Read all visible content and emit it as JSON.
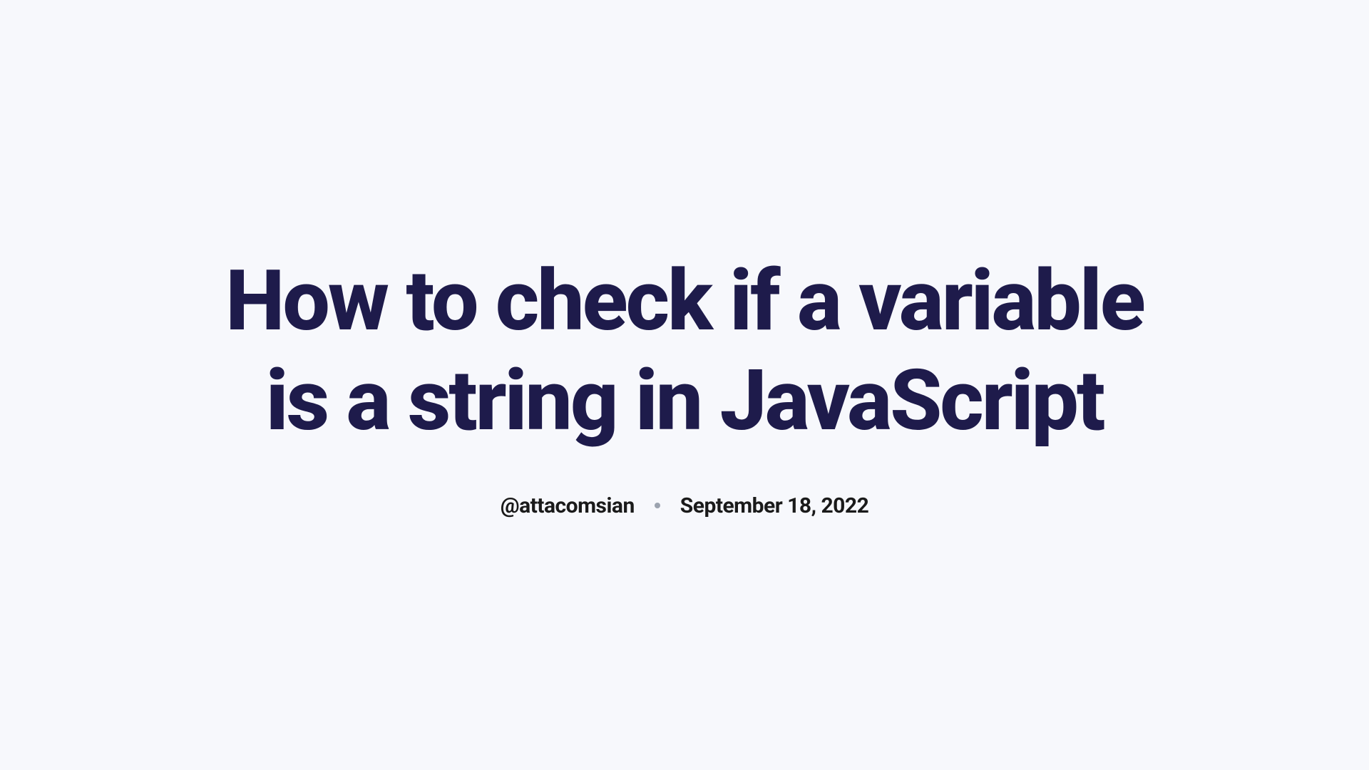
{
  "article": {
    "title": "How to check if a variable is a string in JavaScript",
    "author": "@attacomsian",
    "date": "September 18, 2022"
  }
}
